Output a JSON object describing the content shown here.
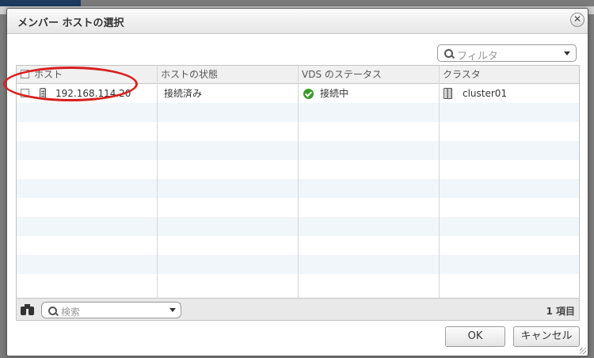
{
  "dialog": {
    "title": "メンバー ホストの選択",
    "close_glyph": "✕"
  },
  "filter": {
    "placeholder": "フィルタ",
    "icon": "search-icon"
  },
  "grid": {
    "columns": [
      "ホスト",
      "ホストの状態",
      "VDS のステータス",
      "クラスタ"
    ],
    "rows": [
      {
        "host": "192.168.114.20",
        "host_state": "接続済み",
        "vds_status": "接続中",
        "cluster": "cluster01"
      }
    ]
  },
  "footer": {
    "search_placeholder": "検索",
    "item_count": "1 項目"
  },
  "buttons": {
    "ok": "OK",
    "cancel": "キャンセル"
  },
  "colors": {
    "status_ok": "#3c9a2a",
    "highlight": "#d8201f",
    "row_alt": "#f1f6fb"
  }
}
